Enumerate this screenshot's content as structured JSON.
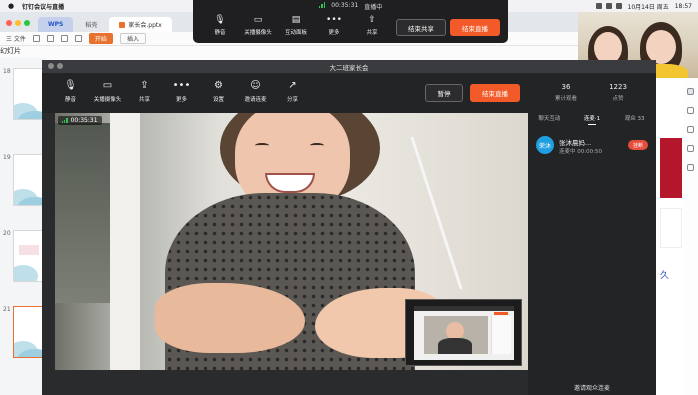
{
  "menubar": {
    "app_name": "钉钉会议与直播",
    "datetime": "10月14日 周五",
    "clock": "18:57"
  },
  "wps": {
    "tabs": [
      "WPS",
      "稻壳",
      "家长会.pptx"
    ],
    "ribbon": [
      "三 文件",
      "开始",
      "插入"
    ],
    "ribbon_right": "幻灯片",
    "slide_numbers": [
      "18",
      "19",
      "20",
      "21"
    ]
  },
  "float_bar": {
    "timer": "00:35:31",
    "status": "直播中",
    "tools": [
      {
        "icon": "mic-icon",
        "glyph": "🎙",
        "label": "静音"
      },
      {
        "icon": "camera-icon",
        "glyph": "▭",
        "label": "关播摄像头"
      },
      {
        "icon": "interactive-panel-icon",
        "glyph": "▤",
        "label": "互动面板"
      },
      {
        "icon": "more-icon",
        "glyph": "•••",
        "label": "更多"
      },
      {
        "icon": "share-icon",
        "glyph": "⇪",
        "label": "共享"
      }
    ],
    "end_share_label": "结束共享",
    "end_live_label": "结束直播"
  },
  "conference": {
    "title": "大二班家长会",
    "tools": [
      {
        "icon": "mic-icon",
        "glyph": "🎙",
        "label": "静音"
      },
      {
        "icon": "camera-icon",
        "glyph": "▭",
        "label": "关播摄像头"
      },
      {
        "icon": "share-screen-icon",
        "glyph": "⇪",
        "label": "共享"
      },
      {
        "icon": "more-icon",
        "glyph": "•••",
        "label": "更多"
      },
      {
        "icon": "settings-icon",
        "glyph": "⚙",
        "label": "设置"
      },
      {
        "icon": "invite-icon",
        "glyph": "☺",
        "label": "邀请连麦"
      },
      {
        "icon": "forward-icon",
        "glyph": "↗",
        "label": "分享"
      }
    ],
    "pause_label": "暂停",
    "end_live_label": "结束直播",
    "stats": [
      {
        "value": "36",
        "label": "累计观看"
      },
      {
        "value": "1223",
        "label": "点赞"
      }
    ],
    "video_timer": "00:35:31",
    "side_panel": {
      "tabs": [
        "聊天互动",
        "连麦·1",
        "观众 33"
      ],
      "active_tab": 1,
      "user": {
        "avatar_text": "荣沐",
        "name": "张沐晨妈...",
        "status": "连麦中 00:00:50",
        "hangup_label": "挂断"
      },
      "invite_label": "邀请观众连麦"
    }
  },
  "colors": {
    "accent_orange": "#f25a29",
    "dark_bg": "#232426",
    "live_green": "#2fc25b",
    "avatar_blue": "#1f9ee0"
  }
}
